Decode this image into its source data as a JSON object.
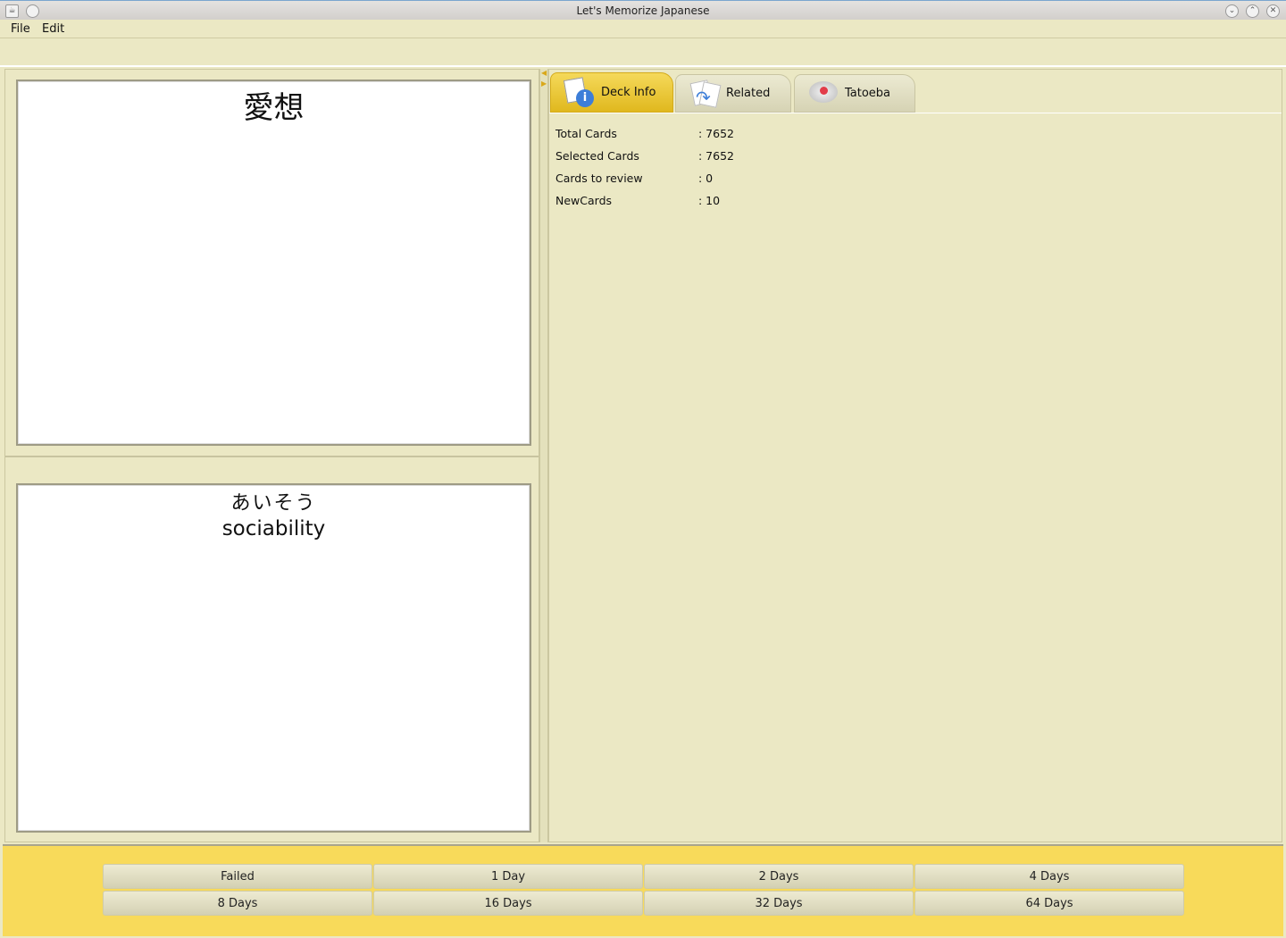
{
  "window": {
    "title": "Let's Memorize Japanese"
  },
  "menu": [
    "File",
    "Edit"
  ],
  "card": {
    "front": "愛想",
    "reading": "あいそう",
    "meaning": "sociability"
  },
  "tabs": [
    {
      "label": "Deck Info"
    },
    {
      "label": "Related"
    },
    {
      "label": "Tatoeba"
    }
  ],
  "deck_info": [
    {
      "label": "Total Cards",
      "value": ": 7652"
    },
    {
      "label": "Selected Cards",
      "value": ": 7652"
    },
    {
      "label": "Cards to review",
      "value": ": 0"
    },
    {
      "label": "NewCards",
      "value": ": 10"
    }
  ],
  "review_buttons": [
    "Failed",
    "1 Day",
    "2 Days",
    "4 Days",
    "8 Days",
    "16 Days",
    "32 Days",
    "64 Days"
  ],
  "colors": {
    "accent": "#f8da5a",
    "panel": "#ebe8c4"
  }
}
